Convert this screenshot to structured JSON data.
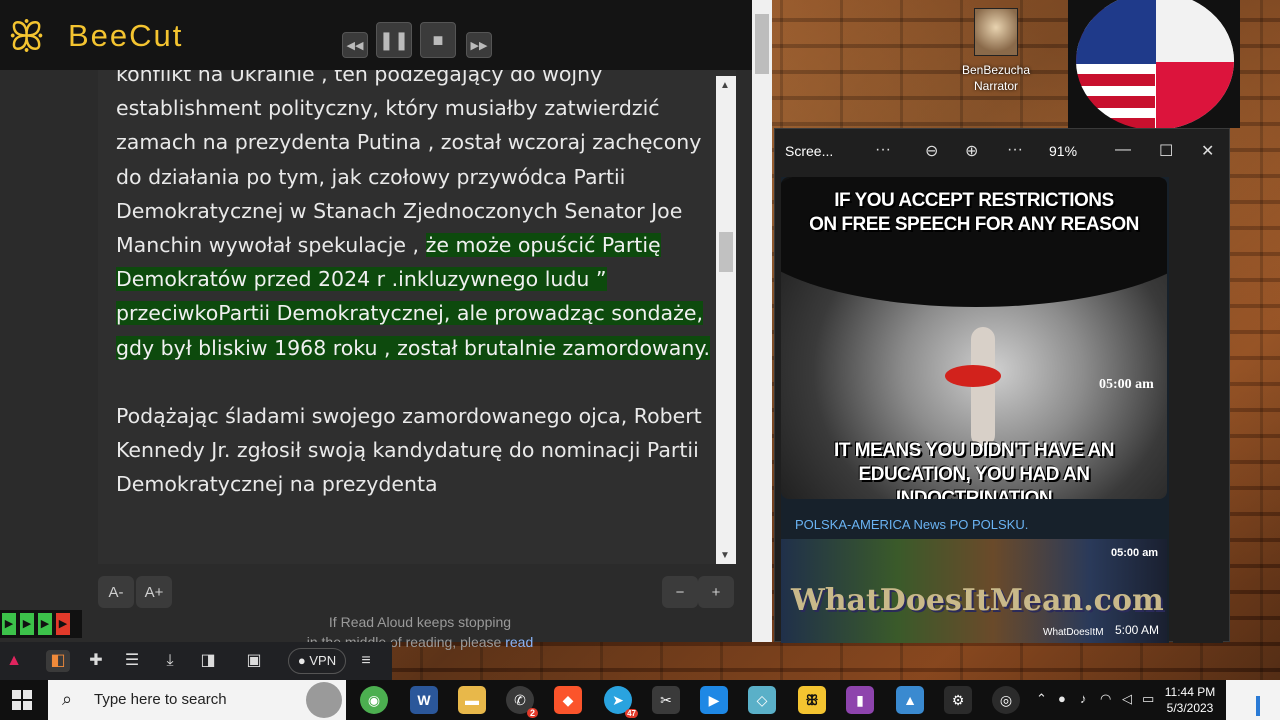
{
  "beecut": {
    "app_name": "BeeCut"
  },
  "reader": {
    "paragraphs": [
      {
        "plain": "konflikt na Ukrainie , ten podżegający do wojny establishment polityczny, który musiałby zatwierdzić zamach na prezydenta Putina , został wczoraj zachęcony do działania po tym, jak czołowy przywódca Partii Demokratycznej w Stanach Zjednoczonych Senator Joe Manchin wywołał spekulacje , ",
        "highlight": "że może opuścić Partię Demokratów przed 2024 r .inkluzywnego ludu ” przeciwkoPartii Demokratycznej, ale prowadząc sondaże, gdy był bliskiw 1968 roku , został brutalnie zamordowany."
      },
      {
        "plain": "Podążając śladami swojego zamordowanego ojca, Robert Kennedy Jr. zgłosił swoją kandydaturę do nominacji Partii Demokratycznej na prezydenta",
        "highlight": ""
      }
    ],
    "font_decrease": "A-",
    "font_increase": "A+",
    "speed_decrease": "−",
    "speed_increase": "+",
    "note_line1": "If Read Aloud keeps stopping",
    "note_line2": "in the middle of reading, please ",
    "note_link": "read"
  },
  "narrator": {
    "name": "BenBezucha",
    "role": "Narrator"
  },
  "screen_window": {
    "title": "Scree...",
    "zoom": "91%",
    "meme_top_line1": "IF YOU ACCEPT RESTRICTIONS",
    "meme_top_line2": "ON FREE SPEECH FOR ANY REASON",
    "meme_bottom_line1": "IT MEANS YOU DIDN'T HAVE AN",
    "meme_bottom_line2": "EDUCATION, YOU HAD AN INDOCTRINATION",
    "meme_time": "05:00 am",
    "channel_name": "POLSKA-AMERICA News PO POLSKU.",
    "image_brand": "WhatDoesItMean.com",
    "image_time_top": "05:00 am",
    "image_watermark": "WhatDoesItM",
    "image_time_bottom": "5:00 AM"
  },
  "browser_toolbar": {
    "vpn_label": "VPN"
  },
  "taskbar": {
    "search_placeholder": "Type here to search",
    "clock_time": "11:44 PM",
    "clock_date": "5/3/2023",
    "whatsapp_badge": "2",
    "telegram_badge": "47"
  },
  "colors": {
    "beecut_accent": "#f4c430",
    "highlight_bg": "#0d4a0d",
    "link": "#8ab4f8",
    "telegram_sender": "#6ab3f3"
  }
}
